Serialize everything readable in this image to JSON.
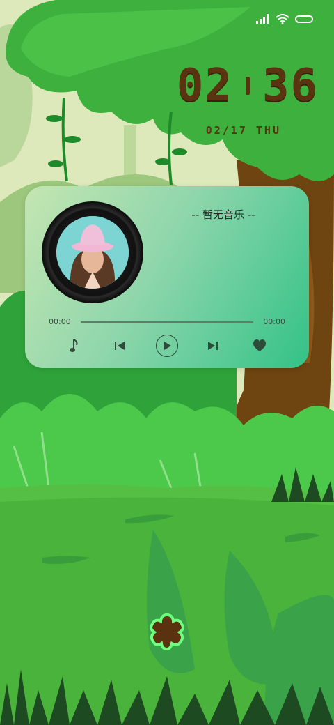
{
  "status_bar": {
    "signal_icon": "signal-icon",
    "wifi_icon": "wifi-icon",
    "battery_icon": "battery-icon"
  },
  "clock": {
    "hours": "02",
    "minutes": "36",
    "date": "02/17 THU"
  },
  "music_widget": {
    "song_title": "-- 暂无音乐 --",
    "elapsed": "00:00",
    "duration": "00:00",
    "progress": 0,
    "controls": {
      "note_icon": "music-note-icon",
      "prev_icon": "previous-icon",
      "play_icon": "play-icon",
      "next_icon": "next-icon",
      "like_icon": "heart-icon"
    }
  },
  "home_button_icon": "flower-icon",
  "colors": {
    "clock": "#5a3411",
    "card_start": "#c4e6b2",
    "card_end": "#33c287",
    "flower_ring": "#6dff7e"
  }
}
